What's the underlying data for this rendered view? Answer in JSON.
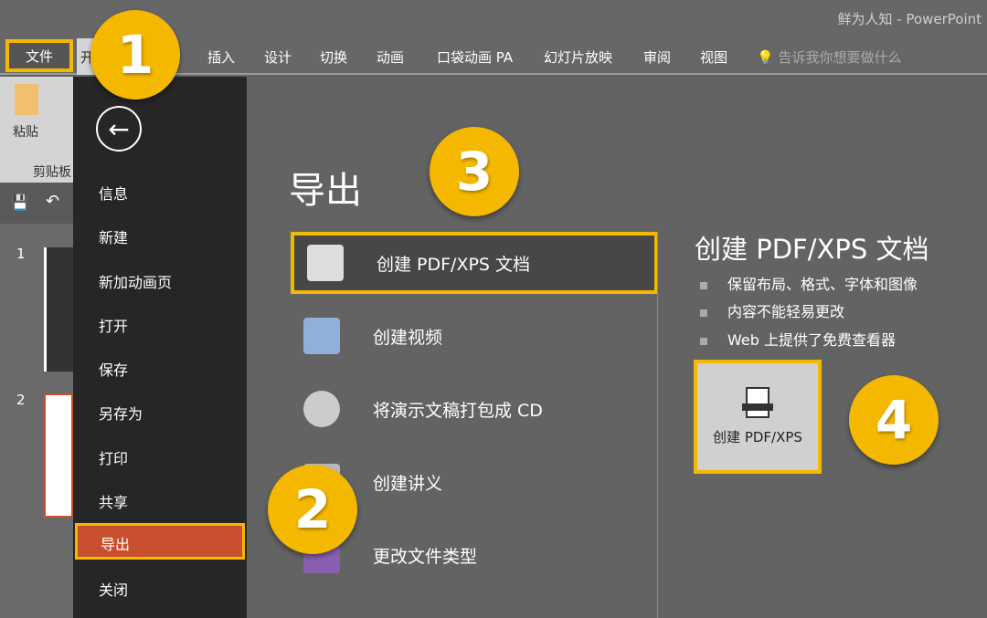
{
  "window_title": "鲜为人知 - PowerPoint",
  "tabs": {
    "file": "文件",
    "home": "开",
    "items": [
      "插入",
      "设计",
      "切换",
      "动画",
      "口袋动画 PA",
      "幻灯片放映",
      "审阅",
      "视图"
    ],
    "tell_me": "告诉我你想要做什么"
  },
  "ribbon": {
    "paste": "粘贴",
    "clipboard": "剪贴板"
  },
  "slides": [
    "1",
    "2"
  ],
  "menu": {
    "items": [
      "信息",
      "新建",
      "新加动画页",
      "打开",
      "保存",
      "另存为",
      "打印",
      "共享",
      "导出",
      "关闭"
    ],
    "selected": "导出"
  },
  "main": {
    "title": "导出",
    "items": [
      "创建 PDF/XPS 文档",
      "创建视频",
      "将演示文稿打包成 CD",
      "创建讲义",
      "更改文件类型"
    ]
  },
  "detail": {
    "title": "创建 PDF/XPS 文档",
    "bullets": [
      "保留布局、格式、字体和图像",
      "内容不能轻易更改",
      "Web 上提供了免费查看器"
    ],
    "button": "创建 PDF/XPS"
  },
  "badges": [
    "1",
    "2",
    "3",
    "4"
  ],
  "colors": {
    "highlight": "#f5b800",
    "selected": "#c8502e",
    "menu_bg": "#262626"
  }
}
